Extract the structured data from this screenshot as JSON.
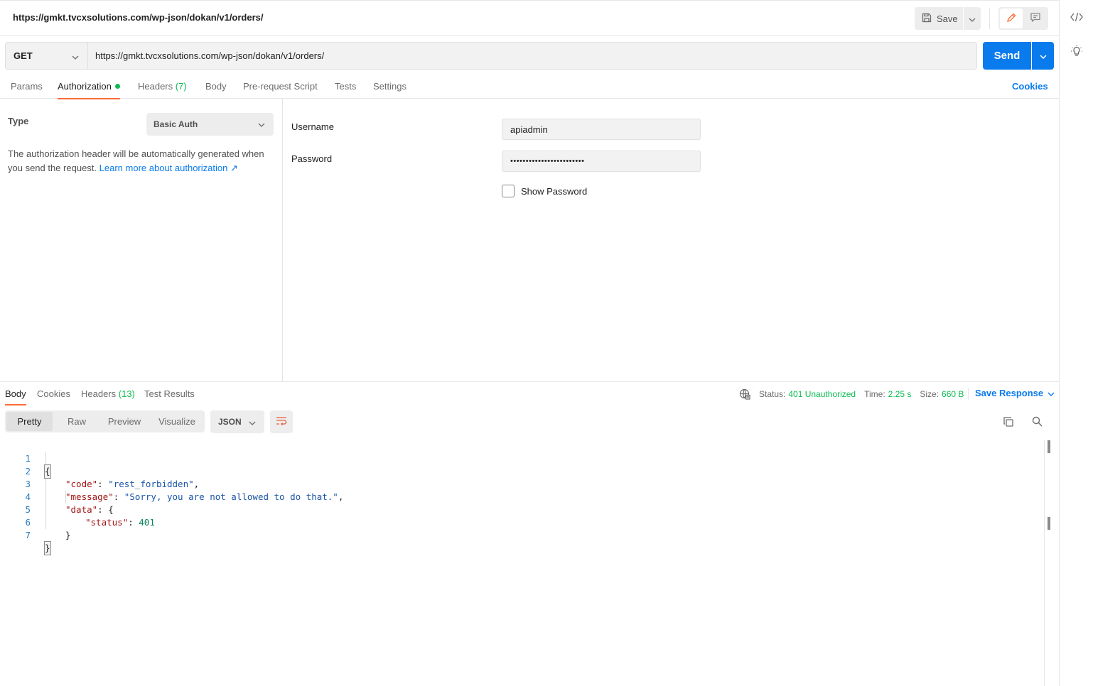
{
  "header": {
    "tab_title": "https://gmkt.tvcxsolutions.com/wp-json/dokan/v1/orders/",
    "save_label": "Save"
  },
  "request": {
    "method": "GET",
    "url": "https://gmkt.tvcxsolutions.com/wp-json/dokan/v1/orders/",
    "send_label": "Send",
    "tabs": {
      "params": "Params",
      "authorization": "Authorization",
      "headers": "Headers",
      "headers_count": "(7)",
      "body": "Body",
      "pre_request": "Pre-request Script",
      "tests": "Tests",
      "settings": "Settings"
    },
    "cookies_label": "Cookies"
  },
  "auth": {
    "type_label": "Type",
    "type_value": "Basic Auth",
    "description": "The authorization header will be automatically generated when you send the request.",
    "learn_more": "Learn more about authorization ↗",
    "username_label": "Username",
    "username_value": "apiadmin",
    "password_label": "Password",
    "password_value": "••••••••••••••••••••••••",
    "show_password_label": "Show Password"
  },
  "response": {
    "tabs": {
      "body": "Body",
      "cookies": "Cookies",
      "headers": "Headers",
      "headers_count": "(13)",
      "test_results": "Test Results"
    },
    "status_label": "Status:",
    "status_value": "401 Unauthorized",
    "time_label": "Time:",
    "time_value": "2.25 s",
    "size_label": "Size:",
    "size_value": "660 B",
    "save_response_label": "Save Response",
    "views": {
      "pretty": "Pretty",
      "raw": "Raw",
      "preview": "Preview",
      "visualize": "Visualize"
    },
    "format": "JSON",
    "code": {
      "line_numbers": [
        "1",
        "2",
        "3",
        "4",
        "5",
        "6",
        "7"
      ],
      "open_brace": "{",
      "code_key": "\"code\"",
      "code_value": "\"rest_forbidden\"",
      "message_key": "\"message\"",
      "message_value": "\"Sorry, you are not allowed to do that.\"",
      "data_key": "\"data\"",
      "status_key": "\"status\"",
      "status_value": "401",
      "close_brace": "}"
    }
  },
  "colors": {
    "accent": "#097bed",
    "active_tab": "#ff6c37",
    "success": "#0cbb52"
  },
  "icons": [
    "save-icon",
    "chevron-down-icon",
    "pencil-icon",
    "comment-icon",
    "code-icon",
    "lightbulb-icon",
    "globe-icon",
    "wrap-lines-icon",
    "copy-icon",
    "search-icon"
  ]
}
